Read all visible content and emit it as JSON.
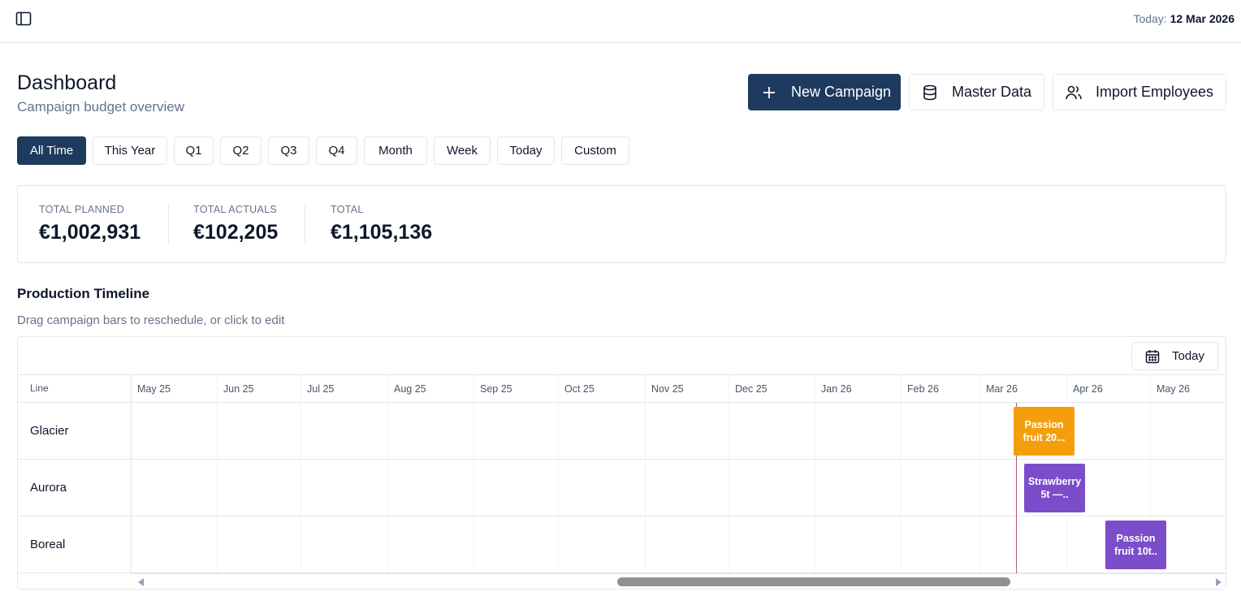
{
  "topbar": {
    "today_prefix": "Today:",
    "today_date": "12 Mar 2026"
  },
  "page": {
    "title": "Dashboard",
    "subtitle": "Campaign budget overview"
  },
  "actions": {
    "new_campaign": "New Campaign",
    "master_data": "Master Data",
    "import_employees": "Import Employees"
  },
  "filters": [
    "All Time",
    "This Year",
    "Q1",
    "Q2",
    "Q3",
    "Q4",
    "Month",
    "Week",
    "Today",
    "Custom"
  ],
  "active_filter": "All Time",
  "totals": {
    "planned_label": "TOTAL PLANNED",
    "planned_value": "€1,002,931",
    "actuals_label": "TOTAL ACTUALS",
    "actuals_value": "€102,205",
    "total_label": "TOTAL",
    "total_value": "€1,105,136"
  },
  "timeline": {
    "title": "Production Timeline",
    "subtitle": "Drag campaign bars to reschedule, or click to edit",
    "today_button": "Today",
    "line_header": "Line",
    "months": [
      "May 25",
      "Jun 25",
      "Jul 25",
      "Aug 25",
      "Sep 25",
      "Oct 25",
      "Nov 25",
      "Dec 25",
      "Jan 26",
      "Feb 26",
      "Mar 26",
      "Apr 26",
      "May 26"
    ],
    "rows": [
      {
        "line": "Glacier",
        "campaign": "Passion fruit 20...",
        "color": "#f59e0b"
      },
      {
        "line": "Aurora",
        "campaign": "Strawberry 5t —..",
        "color": "#7c4dca"
      },
      {
        "line": "Boreal",
        "campaign": "Passion fruit 10t..",
        "color": "#7c4dca"
      }
    ]
  },
  "colors": {
    "primary": "#1e3a5f",
    "orange_bar": "#f59e0b",
    "purple_bar": "#7c4dca",
    "today_marker": "#b85b6e"
  }
}
